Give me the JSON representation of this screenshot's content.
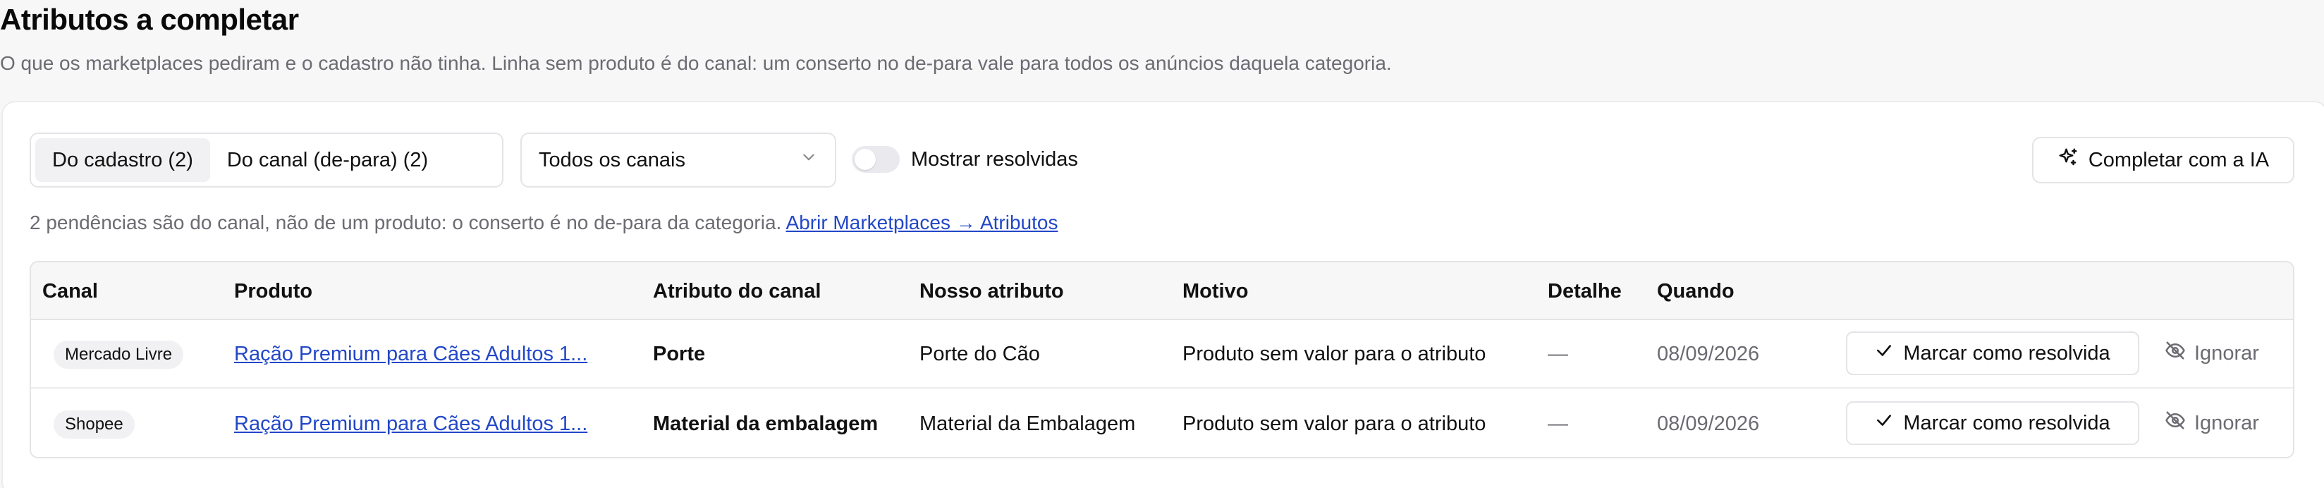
{
  "header": {
    "title": "Atributos a completar",
    "subtitle": "O que os marketplaces pediram e o cadastro não tinha. Linha sem produto é do canal: um conserto no de-para vale para todos os anúncios daquela categoria."
  },
  "toolbar": {
    "segments": [
      {
        "label": "Do cadastro (2)",
        "active": true
      },
      {
        "label": "Do canal (de-para) (2)",
        "active": false
      }
    ],
    "channel_select": {
      "value": "Todos os canais",
      "icon": "chevron-down-icon"
    },
    "toggle": {
      "label": "Mostrar resolvidas",
      "checked": false
    },
    "ai_button": {
      "label": "Completar com a IA",
      "icon": "sparkles-icon"
    }
  },
  "info": {
    "text": "2 pendências são do canal, não de um produto: o conserto é no de-para da categoria.",
    "link": "Abrir Marketplaces → Atributos"
  },
  "table": {
    "columns": [
      "Canal",
      "Produto",
      "Atributo do canal",
      "Nosso atributo",
      "Motivo",
      "Detalhe",
      "Quando"
    ],
    "rows": [
      {
        "canal": "Mercado Livre",
        "produto": "Ração Premium para Cães Adultos 1...",
        "atributo_canal": "Porte",
        "nosso_atributo": "Porte do Cão",
        "motivo": "Produto sem valor para o atributo",
        "detalhe": "—",
        "quando": "08/09/2026",
        "resolve_label": "Marcar como resolvida",
        "ignore_label": "Ignorar"
      },
      {
        "canal": "Shopee",
        "produto": "Ração Premium para Cães Adultos 1...",
        "atributo_canal": "Material da embalagem",
        "nosso_atributo": "Material da Embalagem",
        "motivo": "Produto sem valor para o atributo",
        "detalhe": "—",
        "quando": "08/09/2026",
        "resolve_label": "Marcar como resolvida",
        "ignore_label": "Ignorar"
      }
    ]
  },
  "colors": {
    "link": "#2247c7",
    "muted": "#6b6b72",
    "border": "#e4e4e8",
    "background": "#f7f7f8"
  }
}
